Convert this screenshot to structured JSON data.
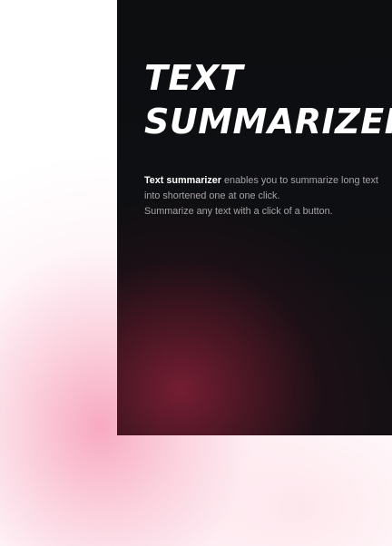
{
  "hero": {
    "title_line1": "TEXT",
    "title_line2": "SUMMARIZER",
    "desc_strong": "Text summarizer",
    "desc_rest": " enables you to summarize long text into shortened one at one click.",
    "desc_line2": "Summarize any text with a click of a button."
  },
  "colors": {
    "card_bg": "#0e0f12",
    "accent_glow": "#7a1e34",
    "page_glow": "#f7a5be",
    "title": "#ffffff",
    "body_text": "#a7a4a6"
  }
}
